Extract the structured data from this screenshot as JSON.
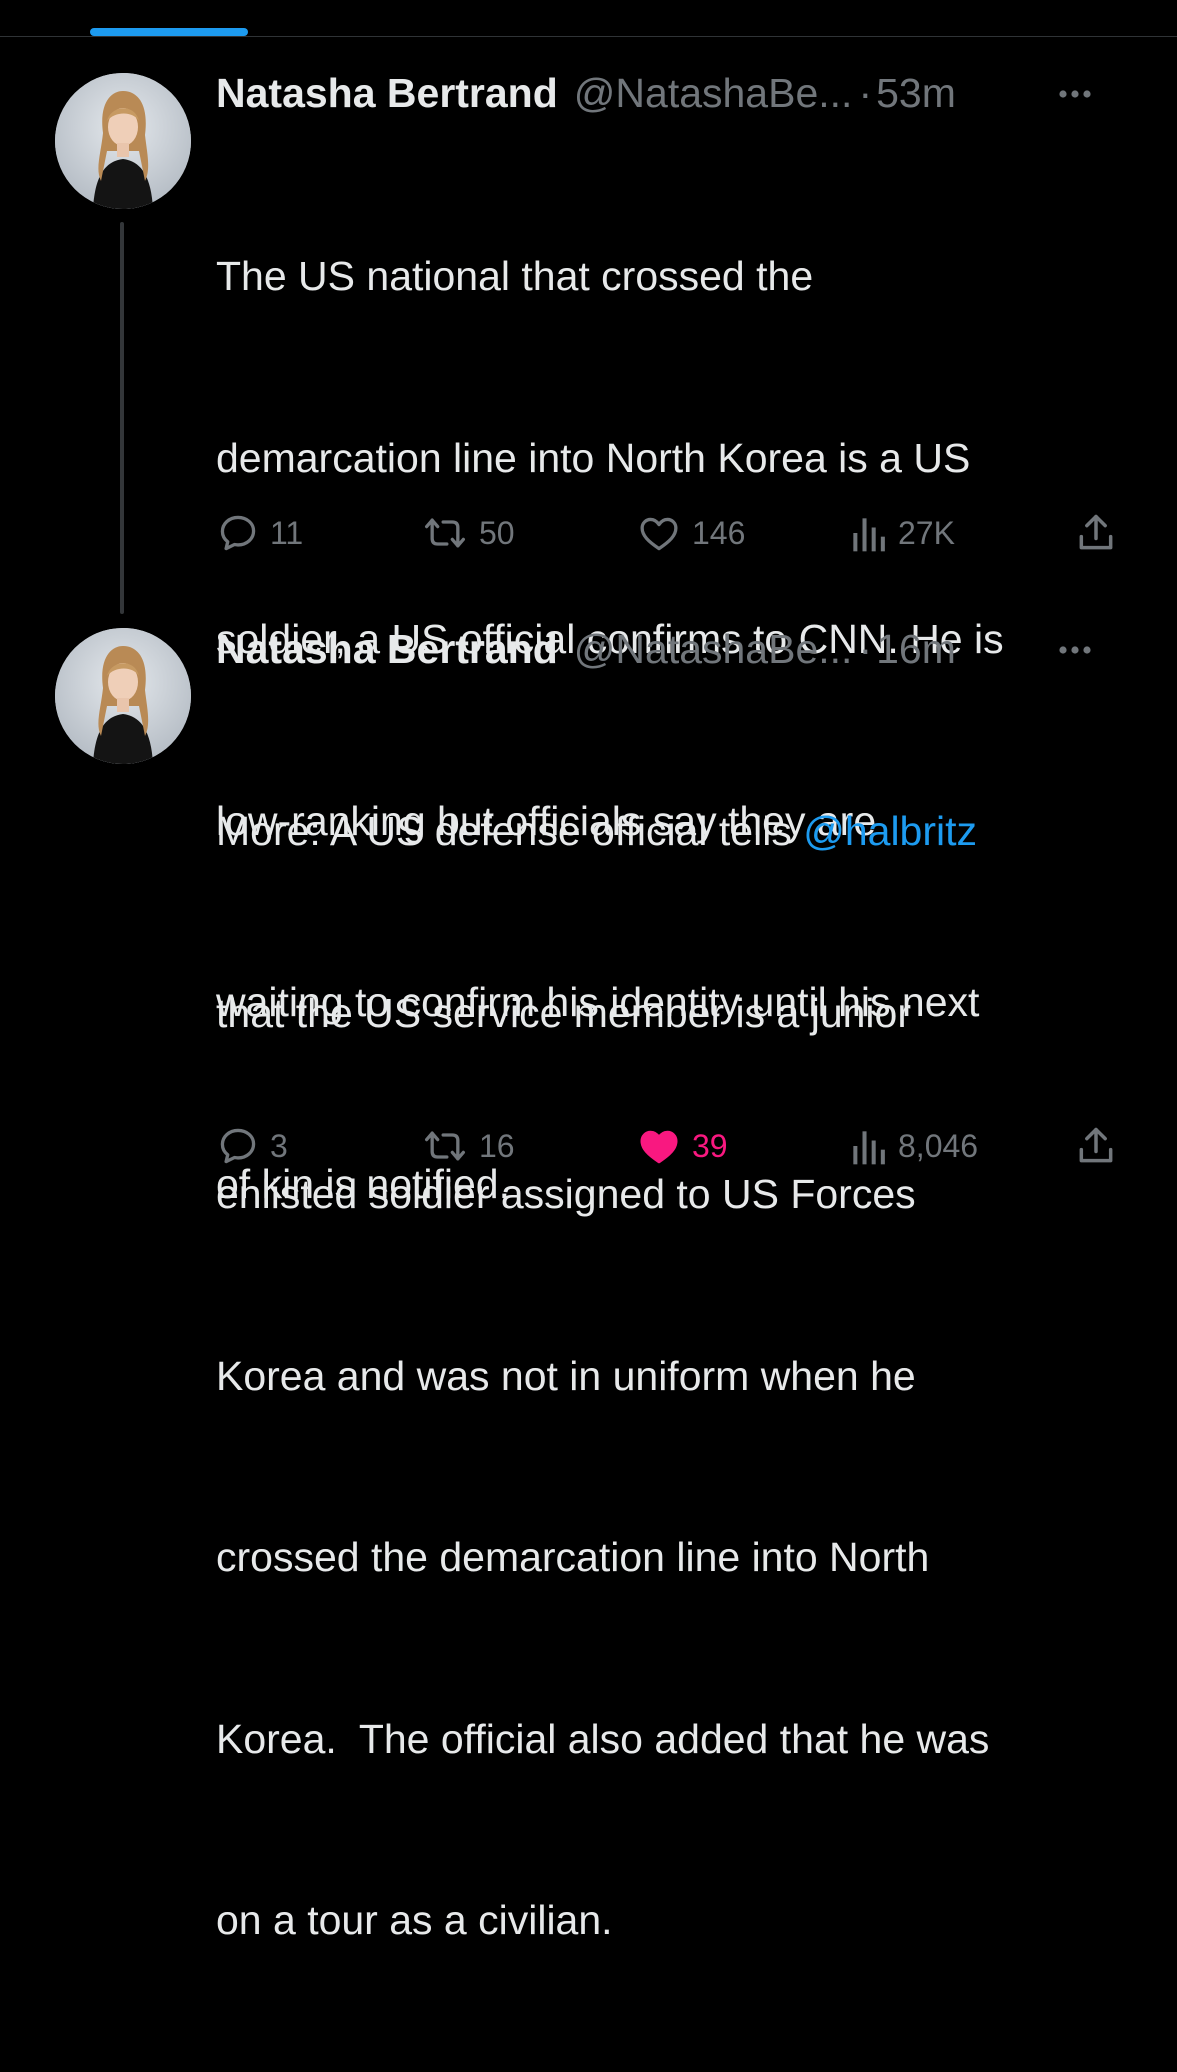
{
  "colors": {
    "background": "#000000",
    "text_primary": "#e7e9ea",
    "text_secondary": "#71767b",
    "accent": "#1d9bf0",
    "like_active": "#f91880",
    "divider": "#2f3336"
  },
  "tweets": [
    {
      "author_name": "Natasha Bertrand",
      "handle": "@NatashaBe...",
      "separator": "·",
      "time": "53m",
      "text": "The US national that crossed the demarcation line into North Korea is a US soldier, a US official confirms to CNN. He is low-ranking but officials say they are waiting to confirm his identity until his next of kin is notified.",
      "text_lines": [
        "The US national that crossed the",
        "demarcation line into North Korea is a US",
        "soldier, a US official confirms to CNN. He is",
        "low-ranking but officials say they are",
        "waiting to confirm his identity until his next",
        "of kin is notified."
      ],
      "replies": "11",
      "retweets": "50",
      "likes": "146",
      "liked": false,
      "views": "27K",
      "icons": [
        "reply-icon",
        "retweet-icon",
        "like-icon",
        "views-icon",
        "share-icon",
        "more-icon"
      ]
    },
    {
      "author_name": "Natasha Bertrand",
      "handle": "@NatashaBe...",
      "separator": "·",
      "time": "16m",
      "text_prefix": "More: A US defense official tells ",
      "mention": "@halbritz",
      "text_lines": [
        "that the US service member is a junior",
        "enlisted soldier assigned to US Forces",
        "Korea and was not in uniform when he",
        "crossed the demarcation line into North",
        "Korea.  The official also added that he was",
        "on a tour as a civilian."
      ],
      "replies": "3",
      "retweets": "16",
      "likes": "39",
      "liked": true,
      "views": "8,046",
      "icons": [
        "reply-icon",
        "retweet-icon",
        "like-filled-icon",
        "views-icon",
        "share-icon",
        "more-icon"
      ]
    }
  ]
}
